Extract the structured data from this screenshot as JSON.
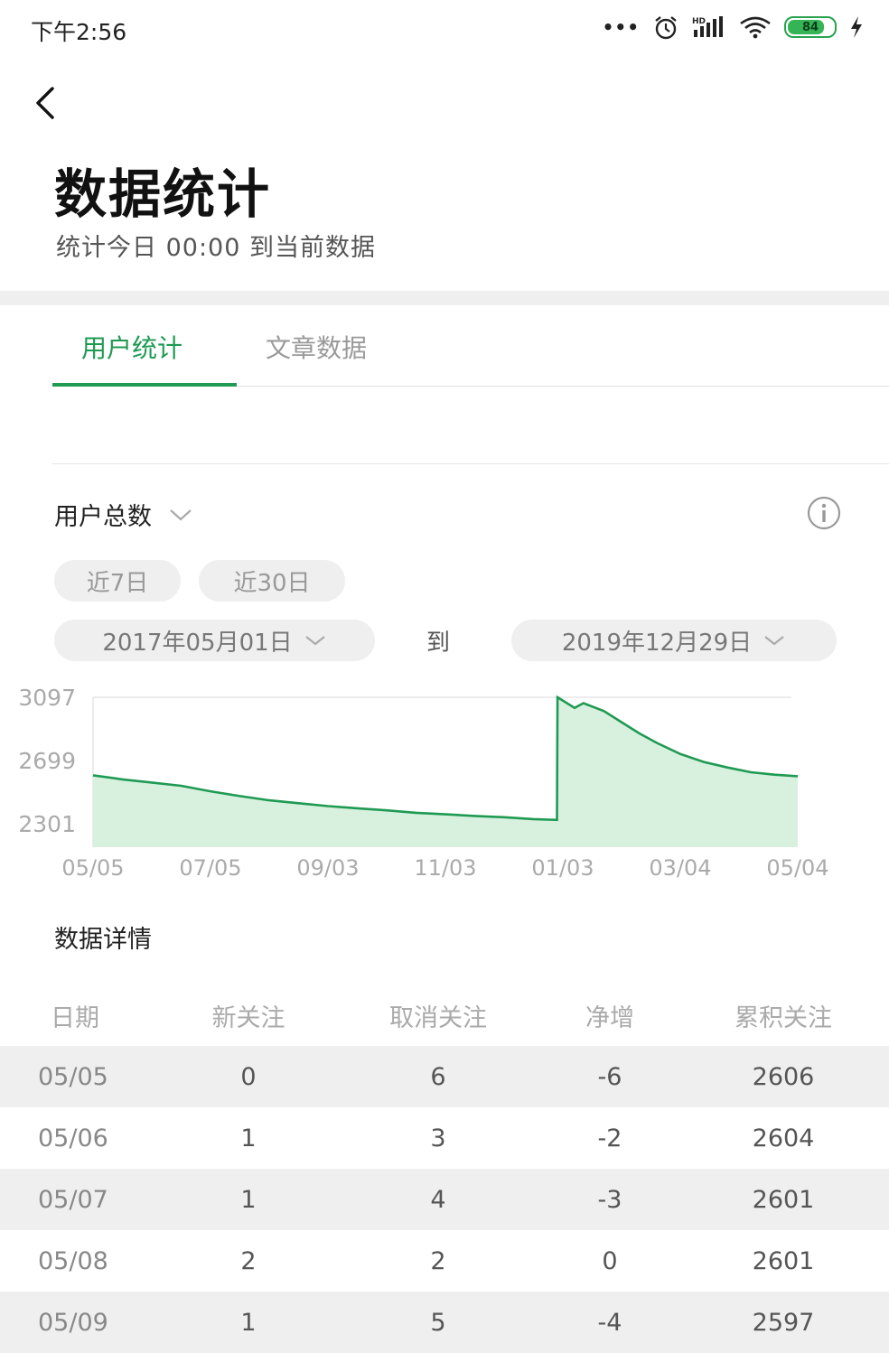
{
  "status": {
    "time": "下午2:56",
    "battery": "84",
    "battery_level": 0.84
  },
  "page": {
    "title": "数据统计",
    "subtitle": "统计今日 00:00 到当前数据"
  },
  "tabs": [
    {
      "label": "用户统计"
    },
    {
      "label": "文章数据"
    }
  ],
  "filter": {
    "metric": "用户总数",
    "quick": [
      {
        "label": "近7日"
      },
      {
        "label": "近30日"
      }
    ],
    "start_date": "2017年05月01日",
    "to": "到",
    "end_date": "2019年12月29日"
  },
  "chart_data": {
    "type": "area",
    "y_ticks": [
      "3097",
      "2699",
      "2301"
    ],
    "ylim": [
      2301,
      3097
    ],
    "x_ticks": [
      "05/05",
      "07/05",
      "09/03",
      "11/03",
      "01/03",
      "03/04",
      "05/04"
    ],
    "series": [
      {
        "values": [
          [
            0,
            2606
          ],
          [
            5,
            2580
          ],
          [
            10,
            2560
          ],
          [
            15,
            2540
          ],
          [
            20,
            2505
          ],
          [
            25,
            2475
          ],
          [
            30,
            2448
          ],
          [
            35,
            2430
          ],
          [
            40,
            2412
          ],
          [
            45,
            2398
          ],
          [
            50,
            2385
          ],
          [
            55,
            2370
          ],
          [
            60,
            2360
          ],
          [
            65,
            2350
          ],
          [
            70,
            2342
          ],
          [
            75,
            2330
          ],
          [
            79,
            2325
          ],
          [
            79.1,
            3097
          ],
          [
            82,
            3030
          ],
          [
            83.5,
            3060
          ],
          [
            87,
            3010
          ],
          [
            90,
            2940
          ],
          [
            93,
            2870
          ],
          [
            96,
            2810
          ],
          [
            100,
            2740
          ],
          [
            104,
            2690
          ],
          [
            108,
            2655
          ],
          [
            112,
            2625
          ],
          [
            116,
            2610
          ],
          [
            120,
            2600
          ]
        ]
      }
    ],
    "x_range": [
      0,
      120
    ],
    "color": "#1f9a52",
    "fill": "#d8f1df",
    "grid": false
  },
  "details": {
    "title": "数据详情",
    "columns": [
      "日期",
      "新关注",
      "取消关注",
      "净增",
      "累积关注"
    ],
    "rows": [
      [
        "05/05",
        "0",
        "6",
        "-6",
        "2606"
      ],
      [
        "05/06",
        "1",
        "3",
        "-2",
        "2604"
      ],
      [
        "05/07",
        "1",
        "4",
        "-3",
        "2601"
      ],
      [
        "05/08",
        "2",
        "2",
        "0",
        "2601"
      ],
      [
        "05/09",
        "1",
        "5",
        "-4",
        "2597"
      ]
    ]
  },
  "colors": {
    "accent": "#1f9a52",
    "chip_bg": "#efefef"
  }
}
